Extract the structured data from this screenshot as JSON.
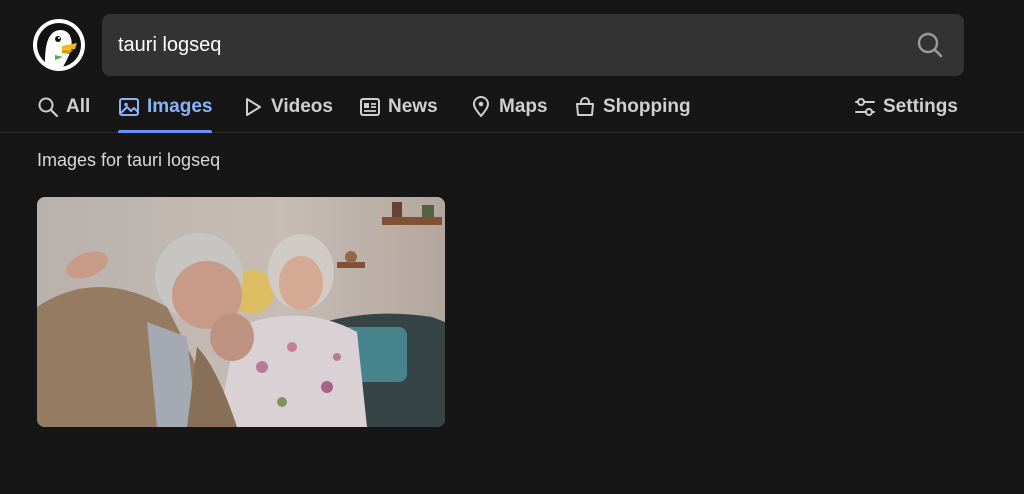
{
  "search": {
    "query": "tauri logseq",
    "placeholder": ""
  },
  "nav": {
    "items": [
      {
        "label": "All",
        "icon": "search-icon"
      },
      {
        "label": "Images",
        "icon": "image-icon",
        "active": true
      },
      {
        "label": "Videos",
        "icon": "play-icon"
      },
      {
        "label": "News",
        "icon": "newspaper-icon"
      },
      {
        "label": "Maps",
        "icon": "map-pin-icon"
      },
      {
        "label": "Shopping",
        "icon": "shopping-bag-icon"
      }
    ],
    "settings_label": "Settings"
  },
  "results": {
    "title": "Images for tauri logseq"
  },
  "colors": {
    "background": "#161616",
    "search_box": "#333333",
    "accent": "#8ab4f8"
  }
}
